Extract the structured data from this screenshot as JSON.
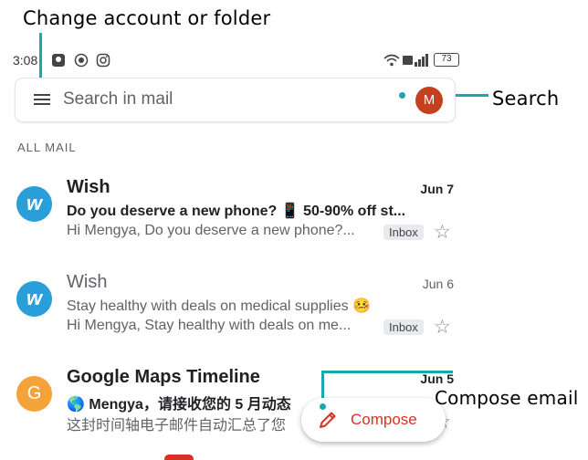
{
  "annotations": {
    "change_account": "Change account or folder",
    "search": "Search",
    "compose_email": "Compose email"
  },
  "status_bar": {
    "time": "3:08",
    "battery": "73"
  },
  "search": {
    "placeholder": "Search in mail",
    "avatar_letter": "M"
  },
  "section_label": "ALL MAIL",
  "emails": [
    {
      "avatar_letter": "w",
      "sender": "Wish",
      "date": "Jun 7",
      "subject": "Do you deserve a new phone? 📱 50-90% off st...",
      "snippet": "Hi Mengya, Do you deserve a new phone?...",
      "badge": "Inbox",
      "unread": true
    },
    {
      "avatar_letter": "w",
      "sender": "Wish",
      "date": "Jun 6",
      "subject": "Stay healthy with deals on medical supplies 🤒",
      "snippet": "Hi Mengya, Stay healthy with deals on me...",
      "badge": "Inbox",
      "unread": false
    },
    {
      "avatar_letter": "G",
      "sender": "Google Maps Timeline",
      "date": "Jun 5",
      "subject": "🌎 Mengya，请接收您的 5 月动态",
      "snippet": "这封时间轴电子邮件自动汇总了您",
      "unread": true
    }
  ],
  "fab": {
    "label": "Compose"
  },
  "colors": {
    "accent_red": "#d93025",
    "annotation_line": "#1aa7b0",
    "wish_blue": "#2a9ed8",
    "google_orange": "#f4a23a",
    "avatar_red": "#c5401f"
  }
}
